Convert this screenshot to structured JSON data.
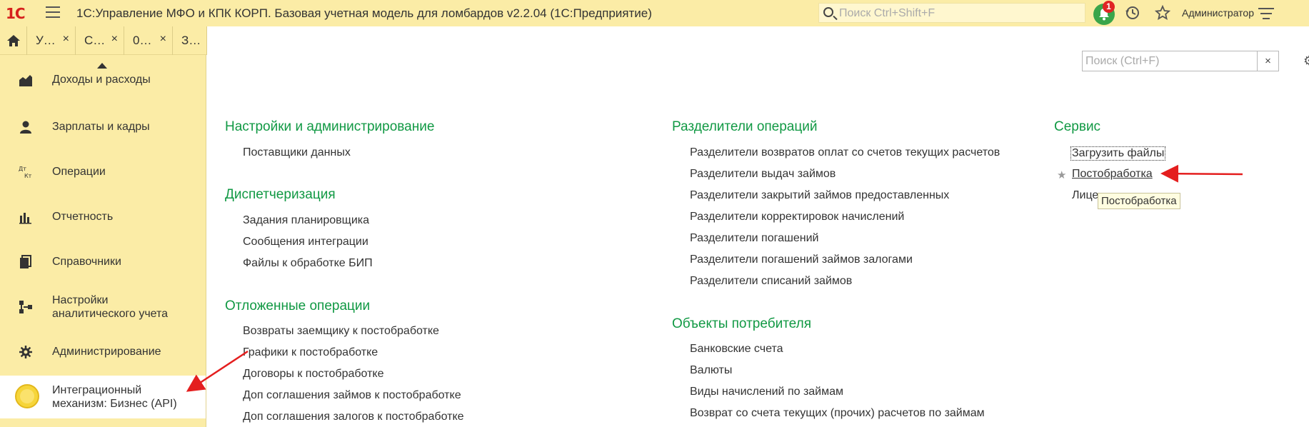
{
  "header": {
    "logo": "1С",
    "title": "1С:Управление МФО и КПК КОРП. Базовая учетная модель для ломбардов v2.2.04  (1С:Предприятие)",
    "search_placeholder": "Поиск Ctrl+Shift+F",
    "notifications_count": "1",
    "user": "Администратор"
  },
  "tabs": [
    {
      "label": "У…",
      "close": "×"
    },
    {
      "label": "С…",
      "close": "×"
    },
    {
      "label": "0…",
      "close": "×"
    },
    {
      "label": "З…",
      "close": ""
    }
  ],
  "sidebar": {
    "items": [
      {
        "label": "Доходы и расходы",
        "icon": "chart-income-icon"
      },
      {
        "label": "Зарплаты и кадры",
        "icon": "person-icon"
      },
      {
        "label": "Операции",
        "icon": "debit-credit-icon",
        "icon_text": "Дт Кт"
      },
      {
        "label": "Отчетность",
        "icon": "bar-chart-icon"
      },
      {
        "label": "Справочники",
        "icon": "books-icon"
      },
      {
        "label": "Настройки\nаналитического учета",
        "icon": "structure-icon"
      },
      {
        "label": "Администрирование",
        "icon": "gear-icon"
      },
      {
        "label": "Интеграционный\nмеханизм: Бизнес (API)",
        "icon": "coin-icon"
      }
    ]
  },
  "content": {
    "search_placeholder": "Поиск (Ctrl+F)",
    "clear": "×",
    "col1": {
      "groups": [
        {
          "title": "Настройки и администрирование",
          "items": [
            "Поставщики данных"
          ]
        },
        {
          "title": "Диспетчеризация",
          "items": [
            "Задания планировщика",
            "Сообщения интеграции",
            "Файлы к обработке БИП"
          ]
        },
        {
          "title": "Отложенные операции",
          "items": [
            "Возвраты заемщику к постобработке",
            "Графики к постобработке",
            "Договоры к постобработке",
            "Доп соглашения займов к постобработке",
            "Доп соглашения залогов к постобработке"
          ]
        }
      ]
    },
    "col2": {
      "groups": [
        {
          "title": "Разделители операций",
          "items": [
            "Разделители возвратов оплат со счетов текущих расчетов",
            "Разделители выдач займов",
            "Разделители закрытий займов предоставленных",
            "Разделители корректировок начислений",
            "Разделители погашений",
            "Разделители погашений займов залогами",
            "Разделители списаний займов"
          ]
        },
        {
          "title": "Объекты потребителя",
          "items": [
            "Банковские счета",
            "Валюты",
            "Виды начислений по займам",
            "Возврат со счета текущих (прочих) расчетов по займам"
          ]
        }
      ]
    },
    "col3": {
      "title": "Сервис",
      "items": [
        "Загрузить файлы",
        "Постобработка",
        "Лице"
      ]
    },
    "tooltip": "Постобработка"
  }
}
